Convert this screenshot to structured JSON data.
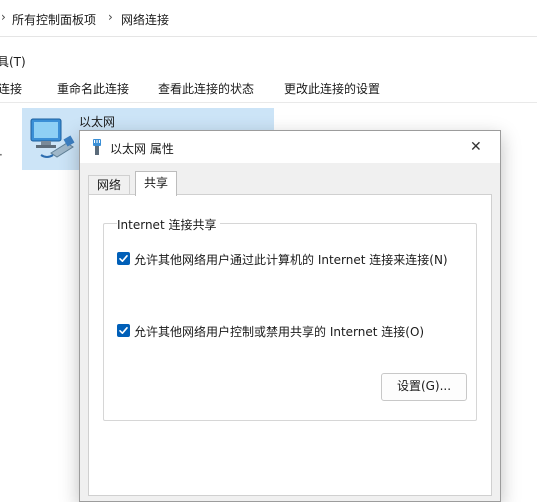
{
  "breadcrumb": {
    "separator": "›",
    "items": [
      "所有控制面板项",
      "网络连接"
    ]
  },
  "menu": {
    "tools": "具(T)"
  },
  "commands": [
    "连接",
    "重命名此连接",
    "查看此连接的状态",
    "更改此连接的设置"
  ],
  "network_item": {
    "name": "以太网",
    "icon": "ethernet-adapter-icon"
  },
  "dialog": {
    "title": "以太网 属性",
    "close_symbol": "✕",
    "tabs": [
      "网络",
      "共享"
    ],
    "active_tab": "共享",
    "group_title": "Internet 连接共享",
    "allow_share": {
      "label": "允许其他网络用户通过此计算机的 Internet 连接来连接(N)",
      "checked": true
    },
    "allow_control": {
      "label": "允许其他网络用户控制或禁用共享的 Internet 连接(O)",
      "checked": true
    },
    "settings_button": "设置(G)..."
  },
  "colors": {
    "selection": "#cce4f7",
    "checkbox": "#005fb8",
    "dialog_bg": "#f0f0f0"
  }
}
